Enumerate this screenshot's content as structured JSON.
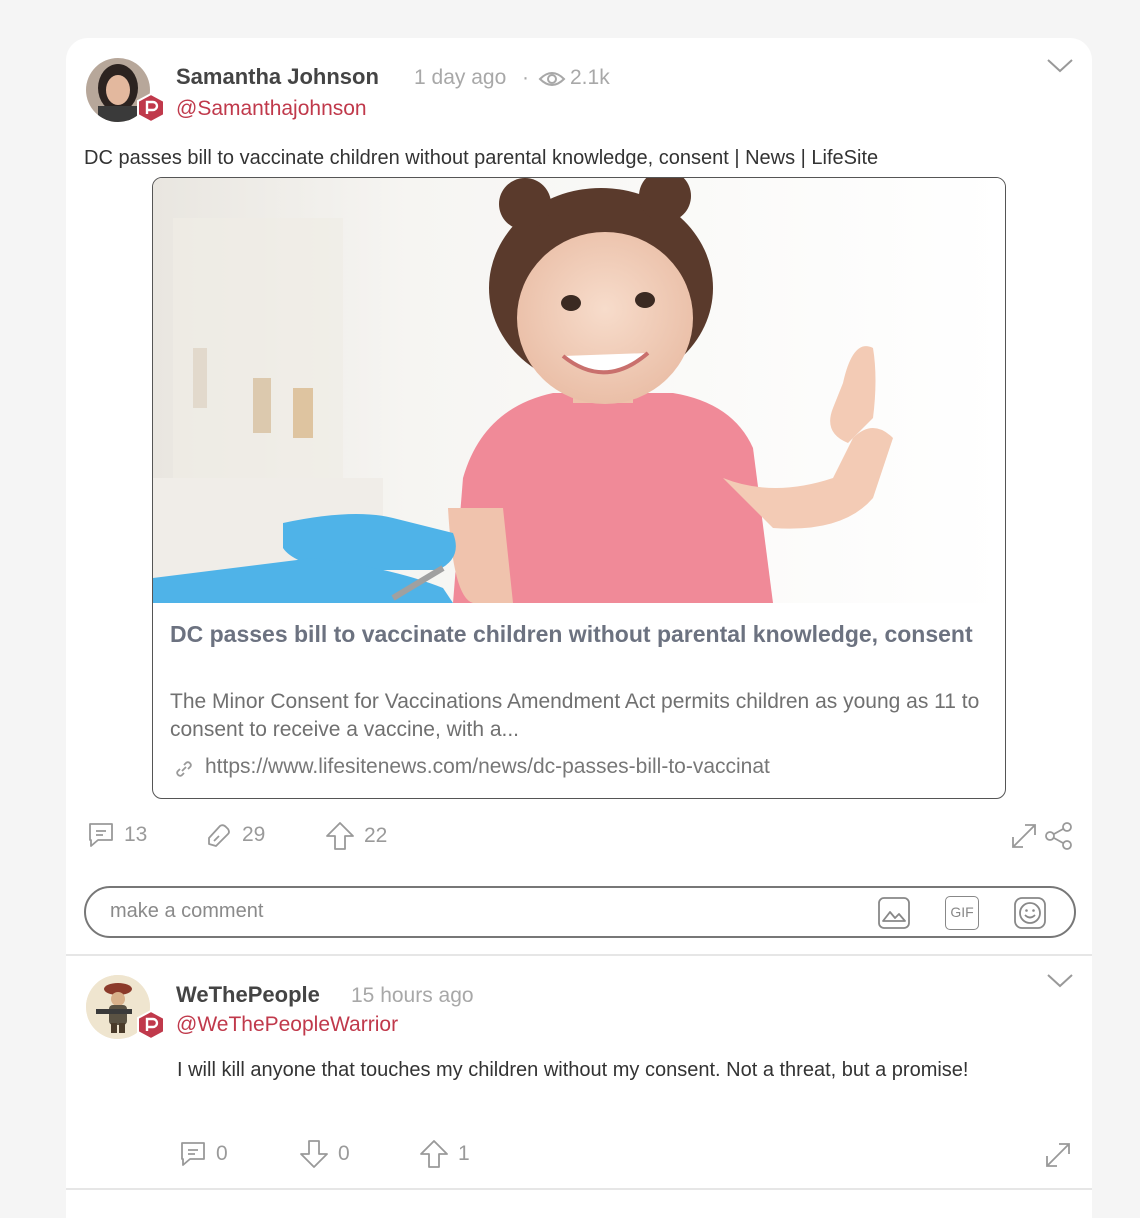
{
  "post": {
    "author_name": "Samantha Johnson",
    "time_ago": "1 day ago",
    "separator": "·",
    "views": "2.1k",
    "handle": "@Samanthajohnson",
    "text": "DC passes bill to vaccinate children without parental knowledge, consent | News | LifeSite",
    "link_card": {
      "title": "DC passes bill to vaccinate children without parental knowledge, consent",
      "description": "The Minor Consent for Vaccinations Amendment Act permits children as young as 11 to consent to receive a vaccine, with a...",
      "url": "https://www.lifesitenews.com/news/dc-passes-bill-to-vaccinat"
    },
    "actions": {
      "comments": "13",
      "echoes": "29",
      "upvotes": "22"
    },
    "comment_input": {
      "placeholder": "make a comment",
      "gif_label": "GIF"
    }
  },
  "reply": {
    "author_name": "WeThePeople",
    "time_ago": "15 hours ago",
    "handle": "@WeThePeopleWarrior",
    "text": "I will kill anyone that touches my children without my consent. Not a threat, but a promise!",
    "actions": {
      "comments": "0",
      "downvotes": "0",
      "upvotes": "1"
    }
  },
  "colors": {
    "brand": "#c0394b",
    "text": "#333333",
    "muted": "#a8a8a8",
    "glove": "#4fb3e8",
    "shirt": "#f08a98"
  },
  "icons": [
    "parler-badge-icon",
    "eye-icon",
    "chevron-down-icon",
    "link-icon",
    "comment-icon",
    "echo-icon",
    "upvote-icon",
    "downvote-icon",
    "expand-icon",
    "share-icon",
    "image-icon",
    "gif-icon",
    "emoji-icon"
  ]
}
